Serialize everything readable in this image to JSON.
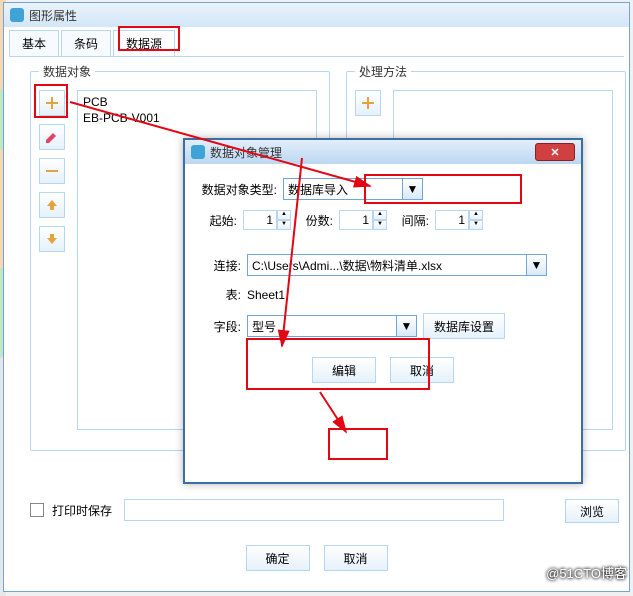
{
  "main_window": {
    "title": "图形属性",
    "tabs": {
      "basic": "基本",
      "barcode": "条码",
      "datasource": "数据源"
    },
    "groups": {
      "data_object": "数据对象",
      "process_method": "处理方法"
    },
    "list_items": [
      "PCB",
      "EB-PCB-V001"
    ],
    "save_on_print_label": "打印时保存",
    "browse_label": "浏览",
    "ok_label": "确定",
    "cancel_label": "取消"
  },
  "toolbar_icons": {
    "add": "add-icon",
    "edit": "pencil-icon",
    "remove": "minus-icon",
    "up": "arrow-up-icon",
    "down": "arrow-down-icon"
  },
  "modal": {
    "title": "数据对象管理",
    "type_label": "数据对象类型:",
    "type_value": "数据库导入",
    "start_label": "起始:",
    "start_value": "1",
    "copies_label": "份数:",
    "copies_value": "1",
    "gap_label": "间隔:",
    "gap_value": "1",
    "conn_label": "连接:",
    "conn_value": "C:\\Users\\Admi...\\数据\\物料清单.xlsx",
    "table_label": "表:",
    "table_value": "Sheet1",
    "field_label": "字段:",
    "field_value": "型号",
    "dbset_label": "数据库设置",
    "edit_label": "编辑",
    "cancel_label": "取消"
  },
  "watermark": "@51CTO博客"
}
